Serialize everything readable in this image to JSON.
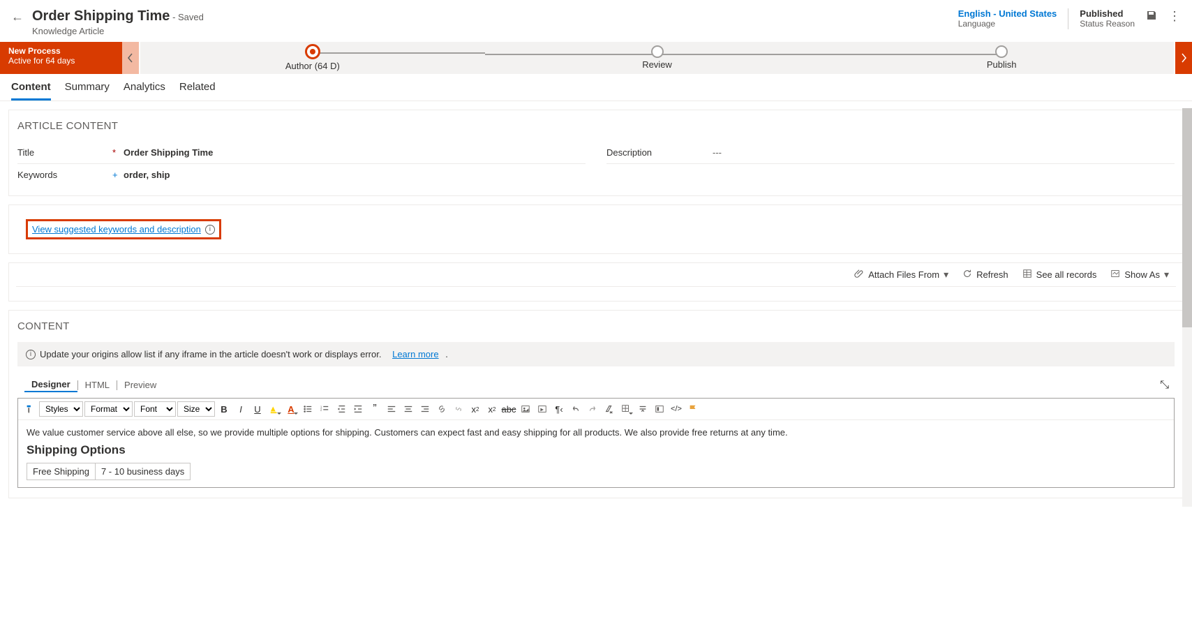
{
  "header": {
    "title": "Order Shipping Time",
    "saved_tag": "- Saved",
    "subtitle": "Knowledge Article",
    "language_value": "English - United States",
    "language_label": "Language",
    "status_value": "Published",
    "status_label": "Status Reason"
  },
  "process": {
    "name": "New Process",
    "duration": "Active for 64 days",
    "stages": [
      {
        "label": "Author  (64 D)",
        "active": true
      },
      {
        "label": "Review",
        "active": false
      },
      {
        "label": "Publish",
        "active": false
      }
    ]
  },
  "tabs": [
    {
      "label": "Content",
      "active": true
    },
    {
      "label": "Summary",
      "active": false
    },
    {
      "label": "Analytics",
      "active": false
    },
    {
      "label": "Related",
      "active": false
    }
  ],
  "article": {
    "section_title": "ARTICLE CONTENT",
    "title_label": "Title",
    "title_value": "Order Shipping Time",
    "keywords_label": "Keywords",
    "keywords_value": "order, ship",
    "desc_label": "Description",
    "desc_value": "---"
  },
  "suggest_link": "View suggested keywords and description",
  "toolbar": {
    "attach": "Attach Files From",
    "refresh": "Refresh",
    "seeall": "See all records",
    "showas": "Show As"
  },
  "content_section": {
    "title": "CONTENT",
    "banner_text": "Update your origins allow list if any iframe in the article doesn't work or displays error.",
    "learn_more": "Learn more",
    "editor_tabs": [
      "Designer",
      "HTML",
      "Preview"
    ],
    "selects": {
      "styles": "Styles",
      "format": "Format",
      "font": "Font",
      "size": "Size"
    },
    "body_intro": "We value customer service above all else, so we provide multiple options for shipping. Customers can expect fast and easy shipping for all products. We also provide free returns at any time.",
    "body_heading": "Shipping Options",
    "table_row": [
      "Free Shipping",
      "7 - 10 business days"
    ]
  }
}
